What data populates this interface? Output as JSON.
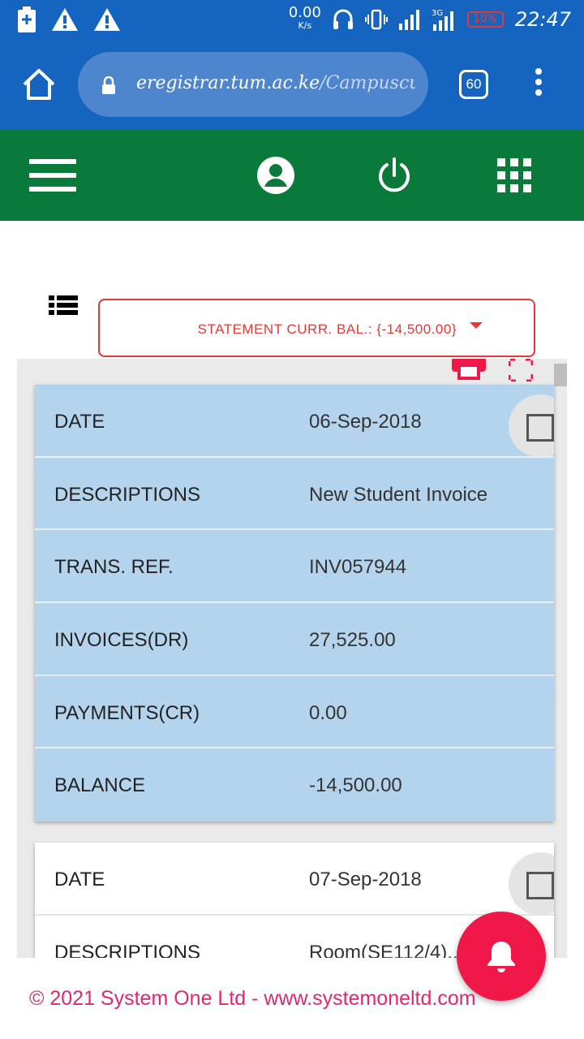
{
  "status_bar": {
    "net_speed": "0.00",
    "net_unit": "K/s",
    "network_type": "3G",
    "battery_percent": "10%",
    "time": "22:47"
  },
  "browser": {
    "url_host": "eregistrar.tum.ac.ke",
    "url_path": "/Campuscure",
    "tab_count": "60"
  },
  "statement": {
    "dropdown_label": "STATEMENT CURR. BAL.: {-14,500.00}"
  },
  "records": [
    {
      "rows": [
        {
          "label": "DATE",
          "value": "06-Sep-2018"
        },
        {
          "label": "DESCRIPTIONS",
          "value": "New Student Invoice"
        },
        {
          "label": "TRANS. REF.",
          "value": "INV057944"
        },
        {
          "label": "INVOICES(DR)",
          "value": "27,525.00"
        },
        {
          "label": "PAYMENTS(CR)",
          "value": "0.00"
        },
        {
          "label": "BALANCE",
          "value": "-14,500.00"
        }
      ]
    },
    {
      "rows": [
        {
          "label": "DATE",
          "value": "07-Sep-2018"
        },
        {
          "label": "DESCRIPTIONS",
          "value": "Room(SE112/4)..."
        }
      ]
    }
  ],
  "footer": {
    "text": "© 2021 System One Ltd - www.systemoneltd.com"
  },
  "colors": {
    "status_bar": "#1565c0",
    "app_bar": "#0a7a3a",
    "accent": "#e53935",
    "card_highlight": "#b3d4ec",
    "fab": "#f01848",
    "footer_text": "#e0276f"
  }
}
